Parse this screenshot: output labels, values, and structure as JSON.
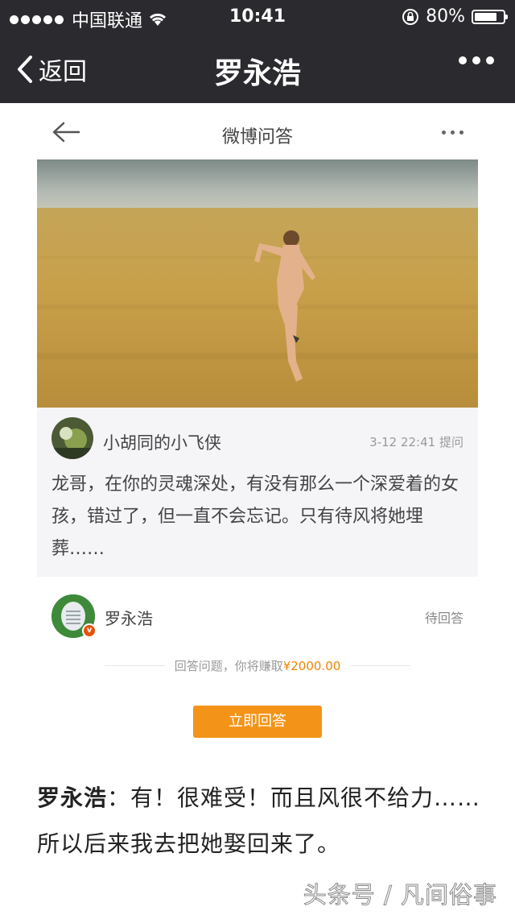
{
  "status_bar": {
    "carrier": "中国联通",
    "time": "10:41",
    "battery": "80%",
    "battery_level": 0.8
  },
  "nav": {
    "back_label": "返回",
    "title": "罗永浩"
  },
  "weibo": {
    "title": "微博问答",
    "question": {
      "username": "小胡同的小飞侠",
      "date": "3-12 22:41",
      "action": "提问",
      "text": "龙哥，在你的灵魂深处，有没有那么一个深爱着的女孩，错过了，但一直不会忘记。只有待风将她埋葬……"
    },
    "answerer": {
      "username": "罗永浩",
      "status": "待回答"
    },
    "reward": {
      "prefix": "回答问题，你将赚取",
      "amount": "¥2000.00"
    },
    "answer_button": "立即回答"
  },
  "caption": {
    "speaker": "罗永浩",
    "separator": "：",
    "text": "有！很难受！而且风很不给力……所以后来我去把她娶回来了。"
  },
  "watermark": "头条号 / 凡间俗事",
  "colors": {
    "nav_bg": "#2b2b2f",
    "accent_orange": "#f39418",
    "reward_orange": "#f08400",
    "question_bg": "#f5f4f7"
  }
}
